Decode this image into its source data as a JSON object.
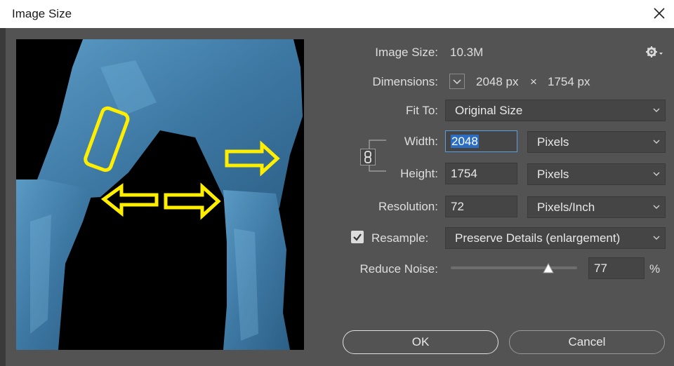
{
  "window": {
    "title": "Image Size"
  },
  "image_size": {
    "label": "Image Size:",
    "value": "10.3M"
  },
  "dimensions": {
    "label": "Dimensions:",
    "width": "2048 px",
    "times": "×",
    "height": "1754 px"
  },
  "fit_to": {
    "label": "Fit To:",
    "value": "Original Size"
  },
  "width": {
    "label": "Width:",
    "value": "2048",
    "unit": "Pixels"
  },
  "height": {
    "label": "Height:",
    "value": "1754",
    "unit": "Pixels"
  },
  "resolution": {
    "label": "Resolution:",
    "value": "72",
    "unit": "Pixels/Inch"
  },
  "resample": {
    "label": "Resample:",
    "checked": true,
    "value": "Preserve Details (enlargement)"
  },
  "reduce_noise": {
    "label": "Reduce Noise:",
    "value": "77",
    "unit": "%",
    "level_percent": 77
  },
  "buttons": {
    "ok": "OK",
    "cancel": "Cancel"
  },
  "colors": {
    "panel": "#535353",
    "field": "#454545",
    "selection": "#2a6dc2",
    "annotation": "#ffee00",
    "figure": "#3f7eab"
  }
}
